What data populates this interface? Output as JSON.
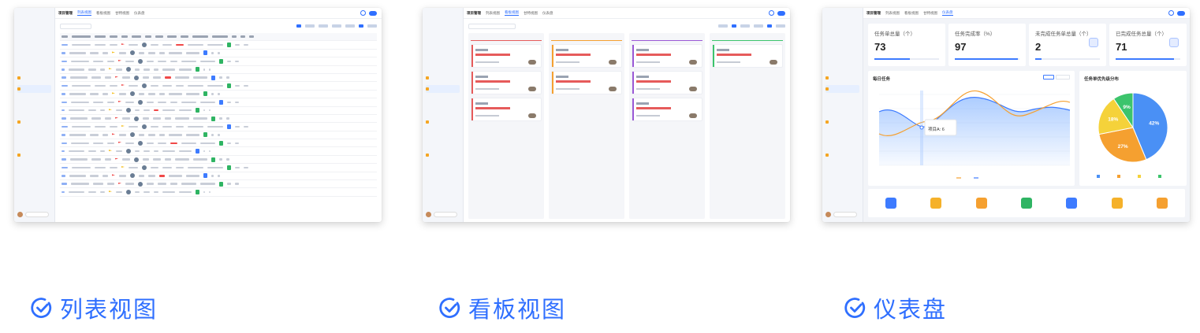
{
  "app": {
    "title": "项目管理",
    "tabs": [
      "列表视图",
      "看板视图",
      "甘特视图",
      "仪表盘"
    ]
  },
  "dashboard": {
    "kpis": [
      {
        "label": "任务单总量（个）",
        "value": "73",
        "progress": 0.55
      },
      {
        "label": "任务完成率（%）",
        "value": "97",
        "progress": 0.97
      },
      {
        "label": "未完成任务单总量（个）",
        "value": "2",
        "progress": 0.1
      },
      {
        "label": "已完成任务总量（个）",
        "value": "71",
        "progress": 0.9
      }
    ],
    "line_title": "每日任务",
    "pie_title": "任务单优先级分布",
    "tooltip": "项目A: 6",
    "pie": [
      {
        "pct": 42,
        "label": "42%",
        "color": "#4a90f5"
      },
      {
        "pct": 27,
        "label": "27%",
        "color": "#f5a030"
      },
      {
        "pct": 18,
        "label": "18%",
        "color": "#f5d23a"
      },
      {
        "pct": 9,
        "label": "9%",
        "color": "#3cc46c"
      }
    ]
  },
  "captions": {
    "list": "列表视图",
    "kanban": "看板视图",
    "dashboard": "仪表盘"
  },
  "colors": {
    "accent": "#2f6fff"
  }
}
